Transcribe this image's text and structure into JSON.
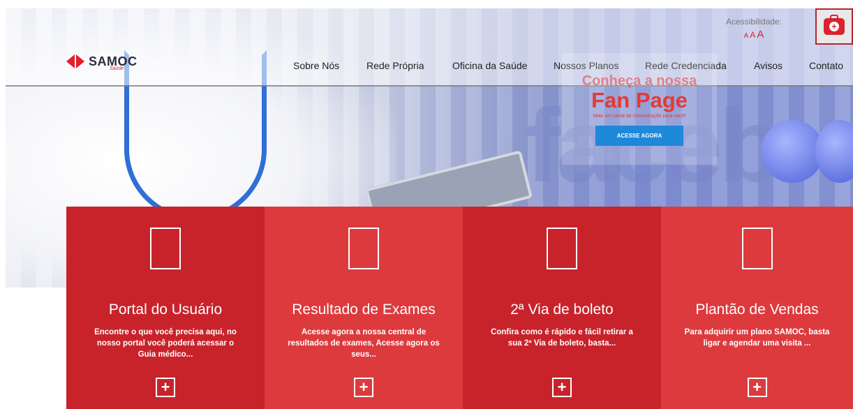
{
  "brand": {
    "name": "SAMOC",
    "tagline": "Saúde",
    "accent": "#e11f2a"
  },
  "nav": {
    "items": [
      {
        "label": "Sobre Nós"
      },
      {
        "label": "Rede Própria"
      },
      {
        "label": "Oficina da Saúde"
      },
      {
        "label": "Nossos Planos"
      },
      {
        "label": "Rede Credenciada"
      },
      {
        "label": "Avisos"
      },
      {
        "label": "Contato"
      }
    ]
  },
  "accessibility": {
    "label": "Acessibilidade:",
    "sizes": [
      "A",
      "A",
      "A"
    ]
  },
  "header_icon": "medkit-icon",
  "promo": {
    "kicker": "Conheça a nossa",
    "title": "Fan Page",
    "subtitle": "Mais um canal de comunicação para você!",
    "button": "ACESSE AGORA",
    "button_color": "#1e88d9"
  },
  "cards": [
    {
      "title": "Portal do Usuário",
      "description": "Encontre o que você precisa aqui, no nosso portal você poderá acessar o Guia médico...",
      "icon": "plus-icon",
      "color": "#c8232b"
    },
    {
      "title": "Resultado de Exames",
      "description": "Acesse agora a nossa central de resultados de exames, Acesse agora os seus...",
      "icon": "plus-icon",
      "color": "#dd3a3e"
    },
    {
      "title": "2ª Via de boleto",
      "description": "Confira como é rápido e fácil retirar a sua 2ª Via de boleto, basta...",
      "icon": "plus-icon",
      "color": "#c8232b"
    },
    {
      "title": "Plantão de Vendas",
      "description": "Para adquirir um plano SAMOC, basta ligar e agendar uma visita ...",
      "icon": "plus-icon",
      "color": "#dd3a3e"
    }
  ]
}
